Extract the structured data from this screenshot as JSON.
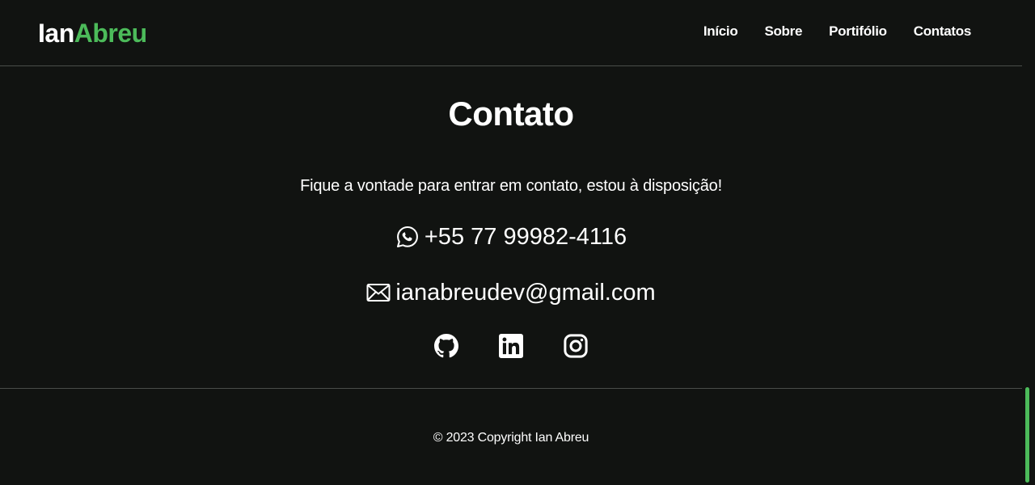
{
  "header": {
    "logo_first": "Ian",
    "logo_second": "Abreu",
    "nav": [
      {
        "label": "Início"
      },
      {
        "label": "Sobre"
      },
      {
        "label": "Portifólio"
      },
      {
        "label": "Contatos"
      }
    ]
  },
  "contact": {
    "title": "Contato",
    "subtitle": "Fique a vontade para entrar em contato, estou à disposição!",
    "phone": "+55 77 99982-4116",
    "email": "ianabreudev@gmail.com",
    "socials": [
      {
        "icon": "github-icon"
      },
      {
        "icon": "linkedin-icon"
      },
      {
        "icon": "instagram-icon"
      }
    ]
  },
  "footer": {
    "copyright": "© 2023 Copyright Ian Abreu"
  },
  "colors": {
    "background": "#111311",
    "accent": "#4cbb5a",
    "text": "#ffffff",
    "divider": "#4a4d4a"
  }
}
